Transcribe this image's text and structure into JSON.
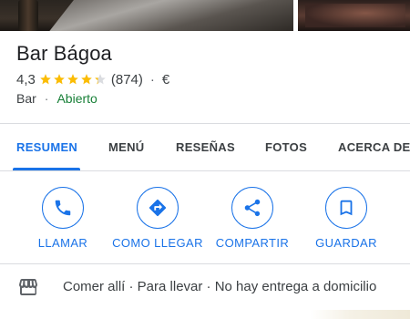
{
  "place": {
    "name": "Bar Bágoa",
    "rating": "4,3",
    "stars": 4.3,
    "review_count": "(874)",
    "separator": "·",
    "price": "€",
    "category": "Bar",
    "status": "Abierto"
  },
  "tabs": [
    {
      "label": "RESUMEN",
      "active": true
    },
    {
      "label": "MENÚ",
      "active": false
    },
    {
      "label": "RESEÑAS",
      "active": false
    },
    {
      "label": "FOTOS",
      "active": false
    },
    {
      "label": "ACERCA DE",
      "active": false
    }
  ],
  "actions": [
    {
      "label": "LLAMAR",
      "icon": "phone-icon"
    },
    {
      "label": "COMO LLEGAR",
      "icon": "directions-icon"
    },
    {
      "label": "COMPARTIR",
      "icon": "share-icon"
    },
    {
      "label": "GUARDAR",
      "icon": "bookmark-icon"
    }
  ],
  "service_options": {
    "icon": "storefront-icon",
    "text": "Comer allí · Para llevar · No hay entrega a domicilio"
  },
  "colors": {
    "accent": "#1a73e8",
    "open": "#188038",
    "star": "#fbbc04",
    "text": "#202124",
    "secondary_text": "#3c4043",
    "divider": "#dadce0"
  }
}
